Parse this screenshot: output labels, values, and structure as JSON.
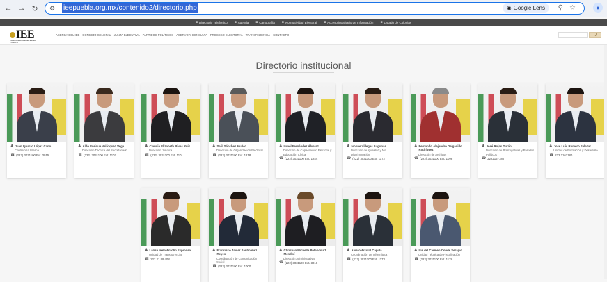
{
  "browser": {
    "url": "ieepuebla.org.mx/contenido2/directorio.php",
    "lens_label": "Google Lens"
  },
  "topbar": {
    "items": [
      "Directorio Telefónico",
      "Agenda",
      "Cartografía",
      "Normatividad Electoral",
      "Acceso igualitario de Información",
      "Listado de Colonias"
    ]
  },
  "site": {
    "logo_text": "IEE",
    "logo_sub": "Instituto Electoral del Estado PUEBLA",
    "menu": [
      "Acerca del IEE",
      "Consejo General",
      "Junta Ejecutiva",
      "Partidos Políticos",
      "Acervo y Consulta",
      "Proceso Electoral",
      "Transparencia",
      "Contacto"
    ],
    "search_button": "Q"
  },
  "page": {
    "title": "Directorio institucional"
  },
  "colors": {
    "accent": "#3367d6",
    "flag_green": "#2e8b3e",
    "flag_red": "#c8303c",
    "banner_yellow": "#e6d24a"
  },
  "people": [
    {
      "name": "Juan Ignacio López Cano",
      "role": "Contraloría Interna",
      "phone": "(222) 3031100 Ext. 3015"
    },
    {
      "name": "Aldo Enrique Velázquez Vega",
      "role": "Dirección Técnica del Secretariado",
      "phone": "(222) 3031100 Ext. 1102"
    },
    {
      "name": "Claudia Elizabeth Rivas Ruiz",
      "role": "Dirección Jurídica",
      "phone": "(222) 3031100 Ext. 1101"
    },
    {
      "name": "Saúl Sánchez Muñoz",
      "role": "Dirección de Organización Electoral",
      "phone": "(222) 3031100 Ext. 1218"
    },
    {
      "name": "Israel Fernández Álvarez",
      "role": "Dirección de Capacitación Electoral y Educación Cívica",
      "phone": "(222) 3031100 Ext. 1244"
    },
    {
      "name": "Ivonne Villegas Lugunas",
      "role": "Dirección de Igualdad y No Discriminación",
      "phone": "(222) 3031100 Ext. 1172"
    },
    {
      "name": "Fernando Alejandro Delgadillo Rodríguez",
      "role": "Dirección de Archivos",
      "phone": "(222) 3031100 Ext. 1098"
    },
    {
      "name": "José Rojas Durán",
      "role": "Dirección de Prerrogativas y Partidos Políticos",
      "phone": "2222167180"
    },
    {
      "name": "José Luis Romero Salazar",
      "role": "Unidad de Formación y Desarrollo",
      "phone": "222 2167180"
    },
    {
      "name": "Larisa Isela Antolín Espinosa",
      "role": "Unidad de Transparencia",
      "phone": "222 21 89 408"
    },
    {
      "name": "Francisco Javier Santibáñez Reyes",
      "role": "Coordinación de Comunicación Social",
      "phone": "(222) 3031100 Ext. 1000"
    },
    {
      "name": "Christian Michelle Betancourt Mendiví",
      "role": "Dirección Administrativa",
      "phone": "(222) 3031100 Ext. 3018"
    },
    {
      "name": "Álvaro Arcival Capilla",
      "role": "Coordinación de Informática",
      "phone": "(222) 3031100 Ext. 1173"
    },
    {
      "name": "Iris del Carmen Conde Serapio",
      "role": "Unidad Técnica de Fiscalización",
      "phone": "(222) 3031100 Ext. 1178"
    }
  ]
}
